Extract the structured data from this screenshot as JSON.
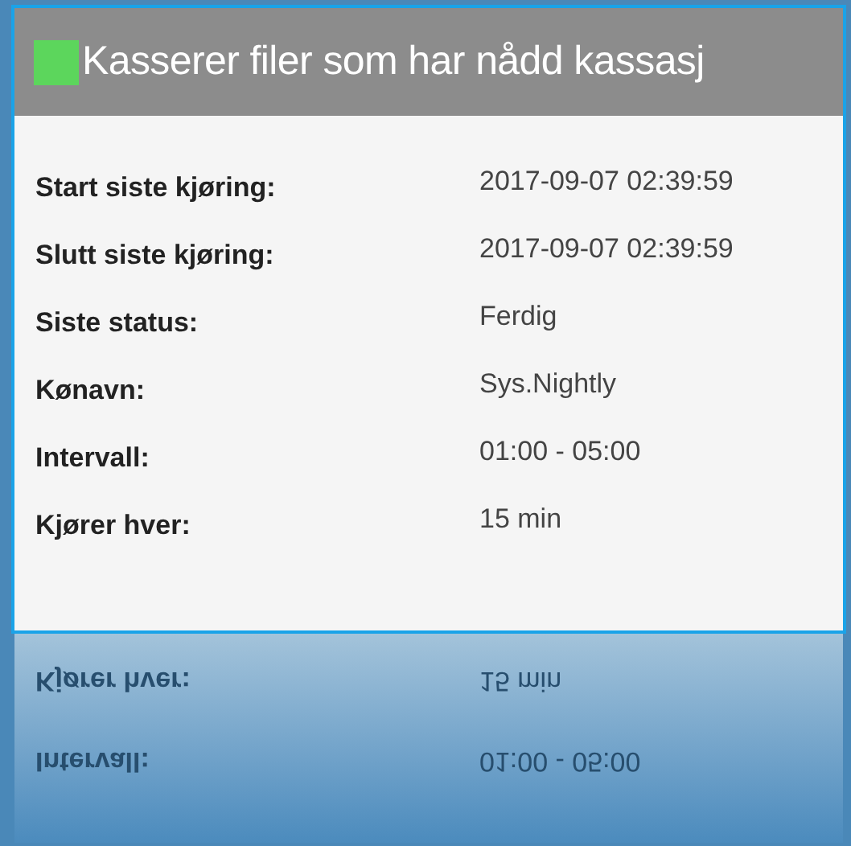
{
  "header": {
    "title": "Kasserer filer som har nådd kassasj",
    "status": {
      "color": "#5cd65c"
    }
  },
  "rows": [
    {
      "label": "Start siste kjøring:",
      "value": "2017-09-07 02:39:59"
    },
    {
      "label": "Slutt siste kjøring:",
      "value": "2017-09-07 02:39:59"
    },
    {
      "label": "Siste status:",
      "value": "Ferdig"
    },
    {
      "label": "Kønavn:",
      "value": "Sys.Nightly"
    },
    {
      "label": "Intervall:",
      "value": "01:00 - 05:00"
    },
    {
      "label": "Kjører hver:",
      "value": "15 min"
    }
  ],
  "reflection": [
    {
      "label": "Kjører hver:",
      "value": "15 min"
    },
    {
      "label": "Intervall:",
      "value": "01:00 - 05:00"
    }
  ]
}
